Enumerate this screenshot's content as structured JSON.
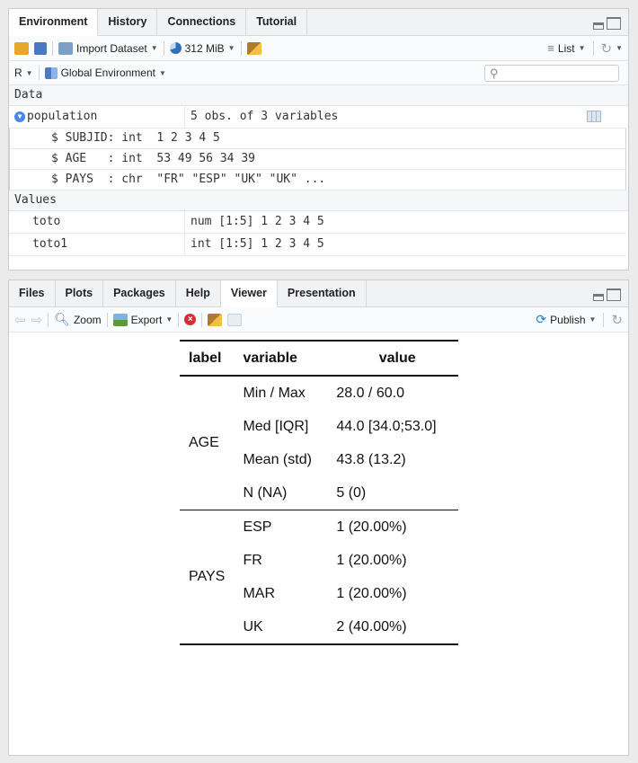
{
  "env": {
    "tabs": [
      "Environment",
      "History",
      "Connections",
      "Tutorial"
    ],
    "toolbar": {
      "import": "Import Dataset",
      "memory": "312 MiB",
      "list": "List"
    },
    "scope": {
      "lang": "R",
      "env": "Global Environment"
    },
    "search_placeholder": "",
    "data_header": "Data",
    "population": {
      "name": "population",
      "desc": "5 obs. of 3 variables",
      "vars": [
        "$ SUBJID: int  1 2 3 4 5",
        "$ AGE   : int  53 49 56 34 39",
        "$ PAYS  : chr  \"FR\" \"ESP\" \"UK\" \"UK\" ..."
      ]
    },
    "values_header": "Values",
    "values": [
      {
        "name": "toto",
        "value": "num [1:5] 1 2 3 4 5"
      },
      {
        "name": "toto1",
        "value": "int [1:5] 1 2 3 4 5"
      }
    ]
  },
  "viewer": {
    "tabs": [
      "Files",
      "Plots",
      "Packages",
      "Help",
      "Viewer",
      "Presentation"
    ],
    "toolbar": {
      "zoom": "Zoom",
      "export": "Export",
      "publish": "Publish"
    },
    "table": {
      "headers": [
        "label",
        "variable",
        "value"
      ],
      "groups": [
        {
          "label": "AGE",
          "rows": [
            [
              "Min / Max",
              "28.0 / 60.0"
            ],
            [
              "Med [IQR]",
              "44.0 [34.0;53.0]"
            ],
            [
              "Mean (std)",
              "43.8 (13.2)"
            ],
            [
              "N (NA)",
              "5 (0)"
            ]
          ]
        },
        {
          "label": "PAYS",
          "rows": [
            [
              "ESP",
              "1 (20.00%)"
            ],
            [
              "FR",
              "1 (20.00%)"
            ],
            [
              "MAR",
              "1 (20.00%)"
            ],
            [
              "UK",
              "2 (40.00%)"
            ]
          ]
        }
      ]
    }
  }
}
